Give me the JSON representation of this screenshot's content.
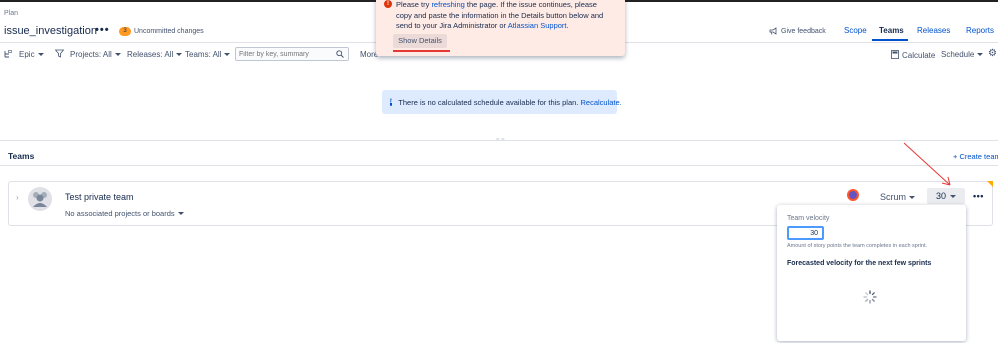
{
  "breadcrumb": "Plan",
  "plan": {
    "title": "issue_investigation",
    "uncommitted_count": "3",
    "uncommitted_label": "Uncommitted changes"
  },
  "error_flag": {
    "line1_pre": "Please try ",
    "line1_link": "refreshing",
    "line1_post": " the page. If the issue continues, please",
    "line2": "copy and paste the information in the Details button below and",
    "line3_pre": "send to your Jira Administrator or ",
    "line3_link": "Atlassian Support",
    "line3_post": ".",
    "button": "Show Details"
  },
  "header": {
    "feedback": "Give feedback",
    "tabs": [
      "Scope",
      "Teams",
      "Releases",
      "Reports"
    ],
    "active_tab": "Teams"
  },
  "toolbar": {
    "hierarchy": "Epic",
    "projects": "Projects: All",
    "releases": "Releases: All",
    "teams": "Teams: All",
    "search_placeholder": "Filter by key, summary",
    "more": "More",
    "calculate": "Calculate",
    "schedule": "Schedule"
  },
  "info_banner": {
    "text": "There is no calculated schedule available for this plan.",
    "link": "Recalculate."
  },
  "teams_section": {
    "title": "Teams",
    "create": "+ Create team"
  },
  "team_row": {
    "name": "Test private team",
    "projects": "No associated projects or boards",
    "method": "Scrum",
    "velocity": "30"
  },
  "velocity_popup": {
    "label": "Team velocity",
    "input_value": "30",
    "help": "Amount of story points the team completes in each sprint.",
    "forecast_title": "Forecasted velocity for the next few sprints"
  },
  "colors": {
    "link": "#0052cc",
    "error_bg": "#ffebe6",
    "error_icon": "#de350b",
    "info_bg": "#deebff",
    "lozenge": "#ff991f",
    "annotation": "#e53935"
  }
}
